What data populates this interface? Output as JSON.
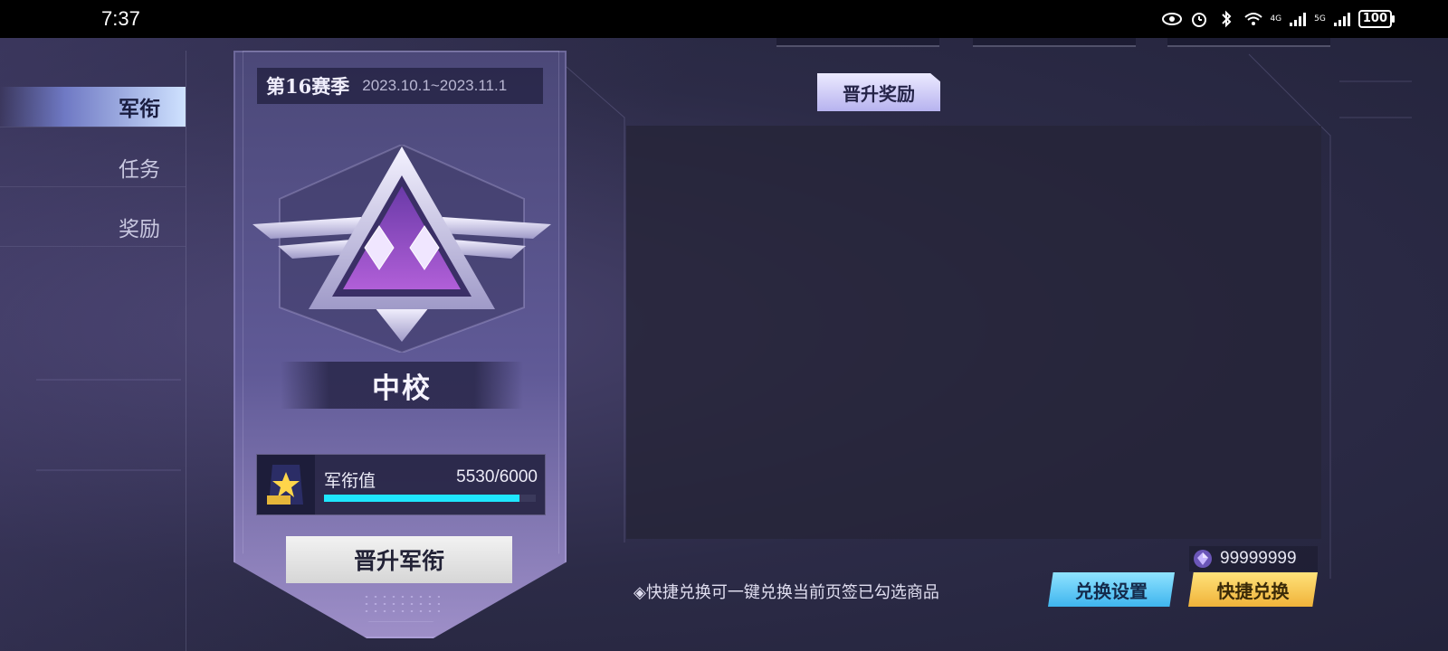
{
  "status_bar": {
    "time": "7:37",
    "battery": "100",
    "net_4g": "4G",
    "net_5g": "5G",
    "icons": [
      "eye-icon",
      "alarm-icon",
      "bluetooth-icon",
      "wifi-icon",
      "signal-icon",
      "signal-icon",
      "battery-icon"
    ]
  },
  "sidebar": {
    "items": [
      {
        "label": "军衔",
        "active": true
      },
      {
        "label": "任务",
        "active": false
      },
      {
        "label": "奖励",
        "active": false
      }
    ]
  },
  "rank_panel": {
    "season_title": "第16赛季",
    "season_dates": "2023.10.1~2023.11.1",
    "rank_name": "中校",
    "progress_label": "军衔值",
    "progress_value": "5530/6000",
    "progress_current": 5530,
    "progress_max": 6000,
    "promote_label": "晋升军衔",
    "emblem_icon": "rank-emblem-icon"
  },
  "rewards": {
    "tab_label": "晋升奖励",
    "currency_value": "99999999",
    "currency_icon": "gem-icon",
    "hint_text": "◈快捷兑换可一键兑换当前页签已勾选商品",
    "settings_label": "兑换设置",
    "quick_label": "快捷兑换"
  },
  "colors": {
    "progress_fill": "#1fe6ff",
    "settings_button": "#3fb5ee",
    "quick_button": "#f0b33a",
    "active_tab": "#cfe2ff"
  }
}
